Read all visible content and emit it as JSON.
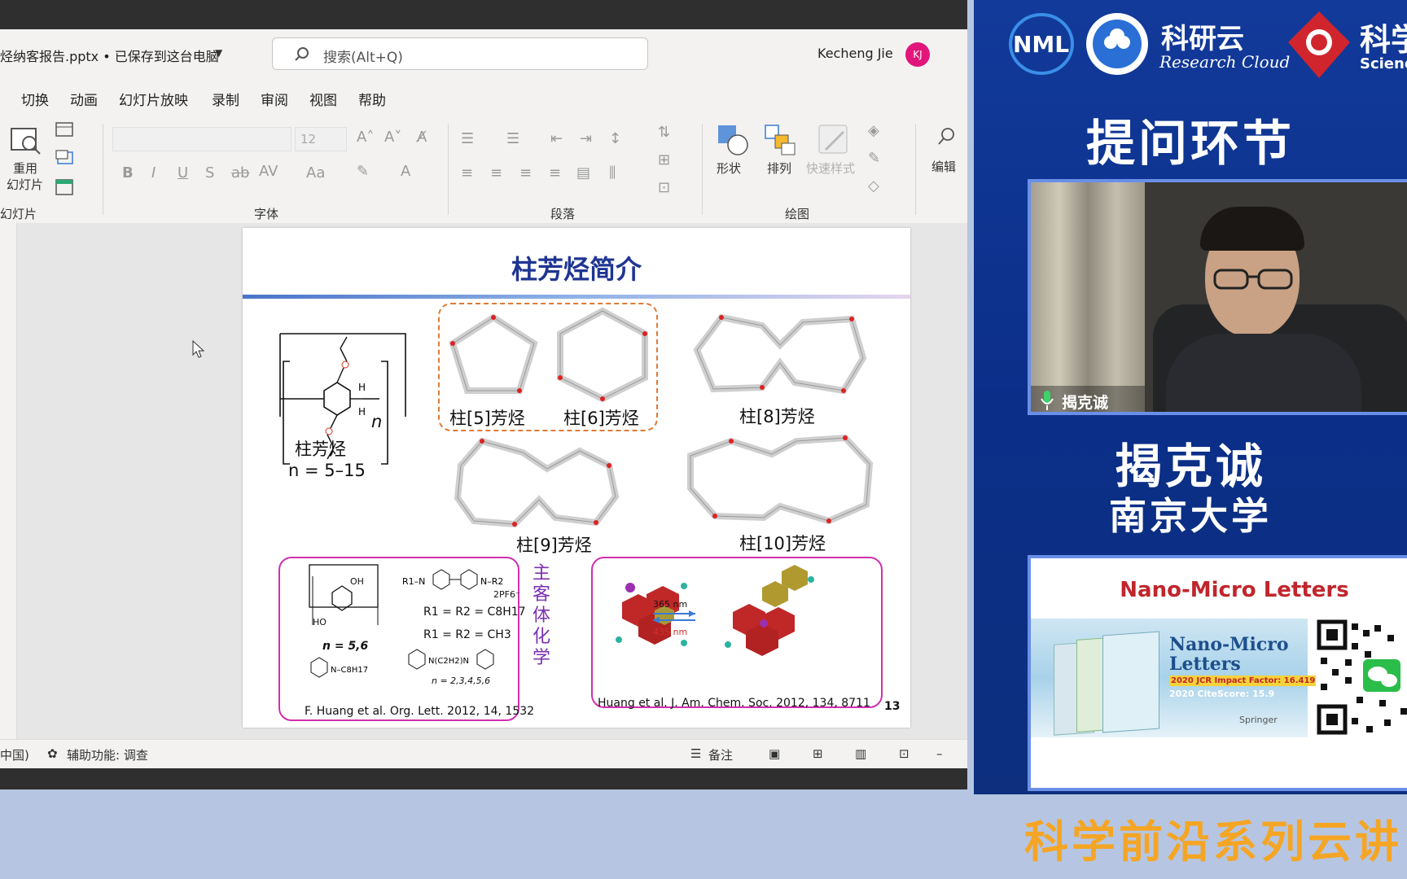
{
  "app": {
    "doc_title": "烃纳客报告.pptx • 已保存到这台电脑",
    "search_placeholder": "搜索(Alt+Q)",
    "user_name": "Kecheng Jie",
    "user_initials": "KJ"
  },
  "menu": [
    "切换",
    "动画",
    "幻灯片放映",
    "录制",
    "审阅",
    "视图",
    "帮助"
  ],
  "ribbon": {
    "reuse_slides_l1": "重用",
    "reuse_slides_l2": "幻灯片",
    "group_slides": "幻灯片",
    "font_size": "12",
    "group_font": "字体",
    "group_paragraph": "段落",
    "shapes": "形状",
    "arrange": "排列",
    "quick_styles": "快速样式",
    "group_drawing": "绘图",
    "editing": "编辑"
  },
  "slide": {
    "title": "柱芳烃简介",
    "n_label": "n",
    "mono_label": "柱芳烃",
    "n_range": "n = 5–15",
    "p5": "柱[5]芳烃",
    "p6": "柱[6]芳烃",
    "p8": "柱[8]芳烃",
    "p9": "柱[9]芳烃",
    "p10": "柱[10]芳烃",
    "hg_label": "主客体化学",
    "r_formula": "R1 = R2 = C8H17",
    "r_formula2": "R1 = R2 = CH3",
    "n56": "n = 5,6",
    "n2346": "n = 2,3,4,5,6",
    "pf6": "2PF6⁻",
    "nm365": "365 nm",
    "nm435": "435 nm",
    "ref1": "F. Huang et al. Org. Lett. 2012, 14, 1532",
    "ref2": "Huang et al. J. Am. Chem. Soc. 2012, 134, 8711",
    "page_no": "13"
  },
  "status": {
    "lang": "中国)",
    "accessibility": "辅助功能: 调查",
    "notes": "备注"
  },
  "right": {
    "logo_brand": "科研云",
    "logo_brand_en": "Research Cloud",
    "logo_sci": "科学",
    "logo_sci_en": "Science",
    "qa": "提问环节",
    "video_name_tag": "揭克诚",
    "speaker": "揭克诚",
    "org": "南京大学",
    "ad_title": "Nano-Micro Letters",
    "ad_journal": "Nano-Micro Letters",
    "ad_if": "2020 JCR Impact Factor: 16.419",
    "ad_cs": "2020 CiteScore: 15.9",
    "ad_pub": "Springer"
  },
  "banner": "科学前沿系列云讲"
}
